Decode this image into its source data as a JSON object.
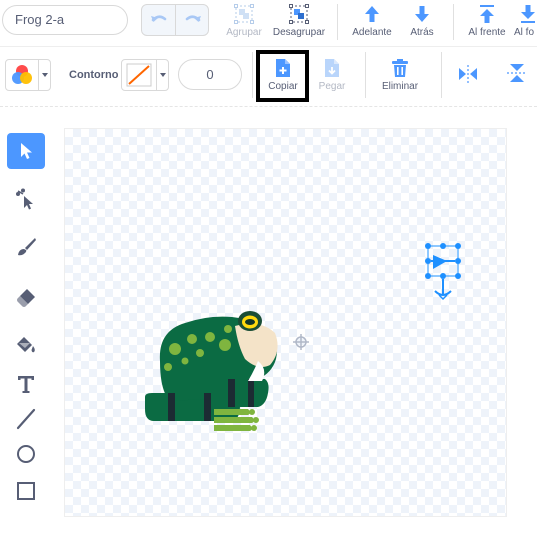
{
  "costume": {
    "name": "Frog 2-a"
  },
  "toolbar_top": {
    "group_label": "Agrupar",
    "ungroup_label": "Desagrupar",
    "forward_label": "Adelante",
    "backward_label": "Atrás",
    "front_label": "Al frente",
    "back_label": "Al fo"
  },
  "toolbar_second": {
    "outline_label": "Contorno",
    "outline_width": "0",
    "copy_label": "Copiar",
    "paste_label": "Pegar",
    "delete_label": "Eliminar"
  },
  "icons": {
    "undo": "undo-icon",
    "redo": "redo-icon",
    "group": "group-icon",
    "ungroup": "ungroup-icon",
    "forward": "forward-icon",
    "backward": "backward-icon",
    "front": "front-icon",
    "back": "back-icon",
    "copy": "copy-icon",
    "paste": "paste-icon",
    "delete": "trash-icon",
    "flip_h": "flip-horizontal-icon",
    "flip_v": "flip-vertical-icon"
  },
  "tools": [
    "select-icon",
    "reshape-icon",
    "brush-icon",
    "eraser-icon",
    "fill-icon",
    "text-icon",
    "line-icon",
    "circle-icon",
    "rectangle-icon"
  ],
  "colors": {
    "accent": "#4c97ff",
    "highlight_box": "#000000",
    "outline_slash": "#ff6600"
  }
}
